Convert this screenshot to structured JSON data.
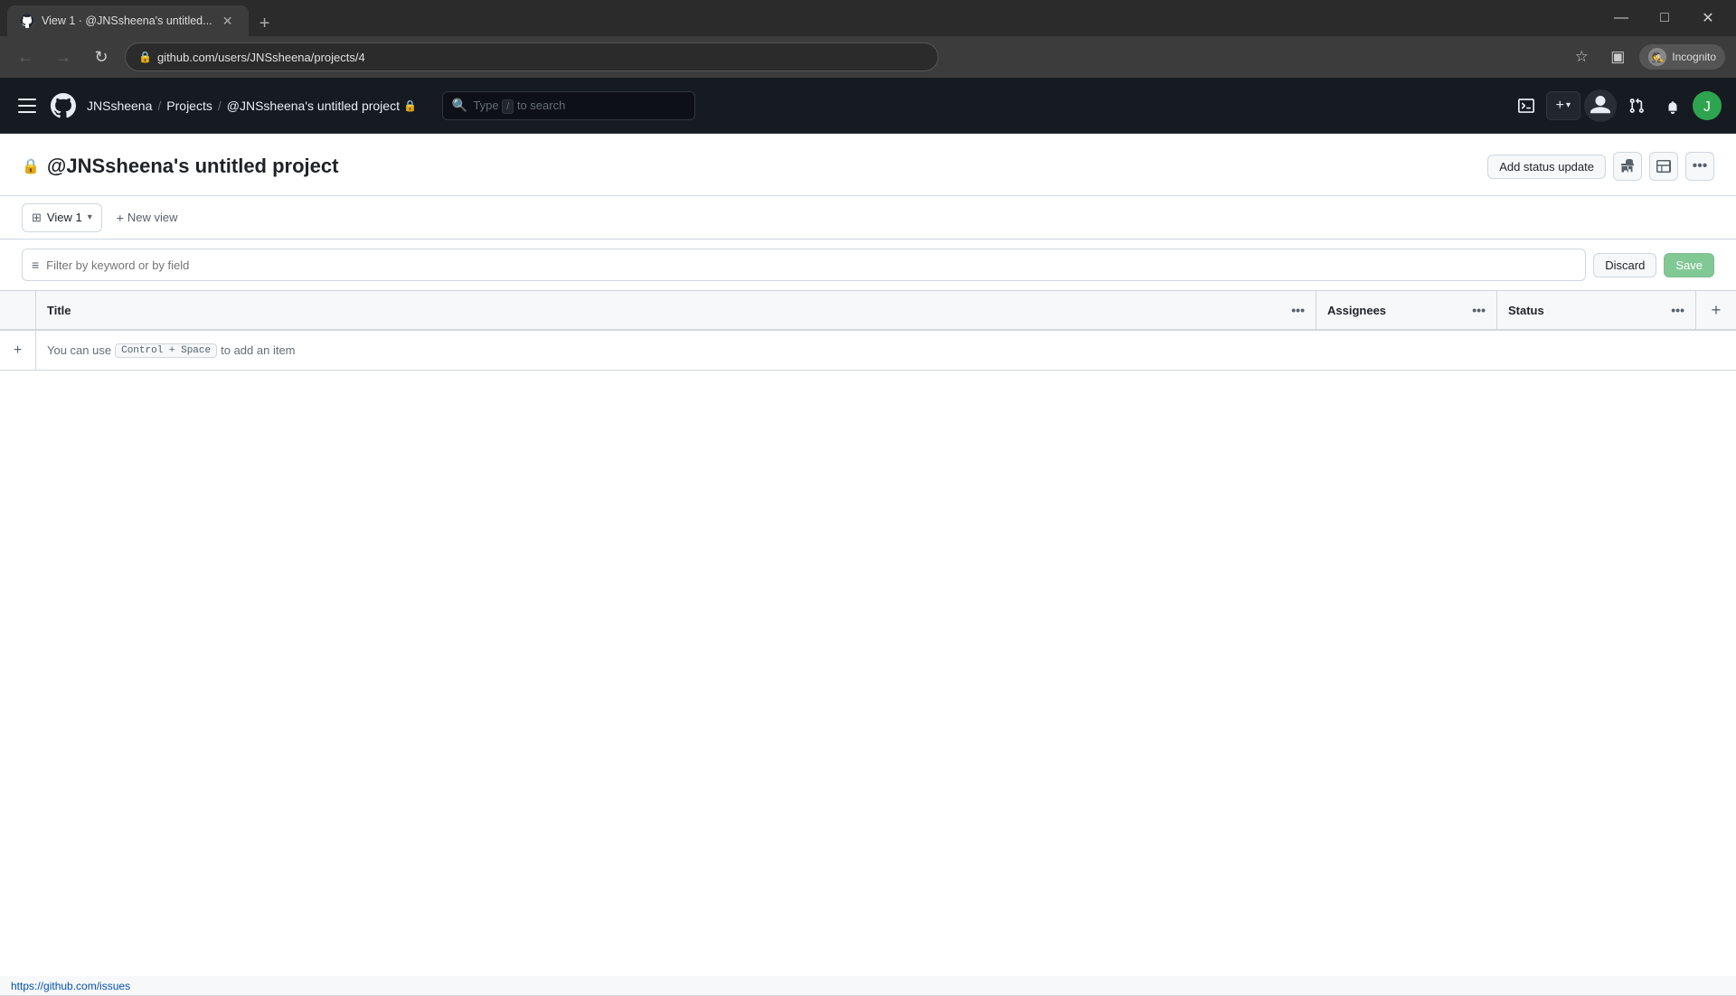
{
  "browser": {
    "tab": {
      "title": "View 1 · @JNSsheena's untitled...",
      "favicon": "🔵"
    },
    "new_tab_label": "+",
    "address": "github.com/users/JNSsheena/projects/4",
    "window_controls": {
      "minimize": "—",
      "maximize": "□",
      "close": "✕"
    },
    "nav": {
      "back": "←",
      "forward": "→",
      "refresh": "↻"
    },
    "incognito_label": "Incognito"
  },
  "github": {
    "header": {
      "menu_label": "☰",
      "logo_label": "GitHub",
      "breadcrumb": {
        "user": "JNSsheena",
        "projects": "Projects",
        "current": "@JNSsheena's untitled project",
        "lock_icon": "🔒"
      },
      "search_placeholder": "Type / to search",
      "search_shortcut": "/",
      "actions": {
        "terminal": ">_",
        "plus_label": "+",
        "chevron": "▾",
        "pull_requests": "⇄",
        "notifications": "🔔"
      }
    },
    "project": {
      "title": "@JNSsheena's untitled project",
      "lock_icon": "🔒",
      "header_actions": {
        "add_status_update": "Add status update",
        "insights_icon": "📈",
        "layout_icon": "⊞",
        "more_icon": "•••"
      },
      "views": {
        "view1_label": "View 1",
        "new_view_label": "New view"
      },
      "filter": {
        "placeholder": "Filter by keyword or by field",
        "discard_label": "Discard",
        "save_label": "Save"
      },
      "table": {
        "columns": {
          "title": "Title",
          "assignees": "Assignees",
          "status": "Status"
        },
        "empty_row": {
          "hint": "You can use ",
          "shortcut": "Control + Space",
          "hint_suffix": " to add an item"
        }
      }
    }
  },
  "status_bar": {
    "url": "https://github.com/issues"
  }
}
